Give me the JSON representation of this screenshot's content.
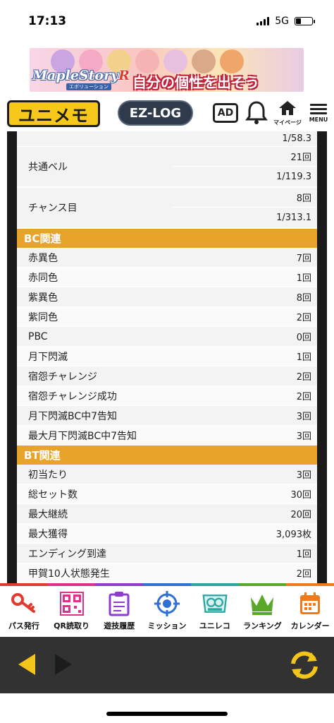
{
  "status": {
    "time": "17:13",
    "network": "5G"
  },
  "banner": {
    "logo_main": "MapleStory",
    "logo_r": "R",
    "logo_sub": "エボリューション",
    "copy": "自分の個性を出そう"
  },
  "header": {
    "brand": "ユニメモ",
    "ezlog": "EZ-LOG",
    "ad": "AD",
    "mypage": "マイページ",
    "menu": "MENU"
  },
  "table": {
    "top_value": "1/58.3",
    "split_rows": [
      {
        "label": "共通ベル",
        "count": "21回",
        "prob": "1/119.3"
      },
      {
        "label": "チャンス目",
        "count": "8回",
        "prob": "1/313.1"
      }
    ],
    "bc_section": "BC関連",
    "bc_rows": [
      {
        "label": "赤異色",
        "value": "7回"
      },
      {
        "label": "赤同色",
        "value": "1回"
      },
      {
        "label": "紫異色",
        "value": "8回"
      },
      {
        "label": "紫同色",
        "value": "2回"
      },
      {
        "label": "PBC",
        "value": "0回"
      },
      {
        "label": "月下閃滅",
        "value": "1回"
      },
      {
        "label": "宿怨チャレンジ",
        "value": "2回"
      },
      {
        "label": "宿怨チャレンジ成功",
        "value": "2回"
      },
      {
        "label": "月下閃滅BC中7告知",
        "value": "3回"
      },
      {
        "label": "最大月下閃滅BC中7告知",
        "value": "3回"
      }
    ],
    "bt_section": "BT関連",
    "bt_rows": [
      {
        "label": "初当たり",
        "value": "3回"
      },
      {
        "label": "総セット数",
        "value": "30回"
      },
      {
        "label": "最大継続",
        "value": "20回"
      },
      {
        "label": "最大獲得",
        "value": "3,093枚"
      },
      {
        "label": "エンディング到達",
        "value": "1回"
      },
      {
        "label": "甲賀10人状態発生",
        "value": "2回"
      }
    ]
  },
  "bottom_nav": [
    {
      "label": "パス発行",
      "icon": "key-icon",
      "color": "#e33a2f"
    },
    {
      "label": "QR読取り",
      "icon": "qr-icon",
      "color": "#e0308a"
    },
    {
      "label": "遊技履歴",
      "icon": "clipboard-icon",
      "color": "#8e3bd0"
    },
    {
      "label": "ミッション",
      "icon": "target-icon",
      "color": "#2f6fd6"
    },
    {
      "label": "ユニレコ",
      "icon": "unireco-icon",
      "color": "#2aa6a0"
    },
    {
      "label": "ランキング",
      "icon": "crown-icon",
      "color": "#5aa82a"
    },
    {
      "label": "カレンダー",
      "icon": "calendar-icon",
      "color": "#f07a1a"
    }
  ],
  "colors": {
    "section": "#e8a42a",
    "browser_bar": "#323232",
    "arrow_yellow": "#f3c41a"
  }
}
